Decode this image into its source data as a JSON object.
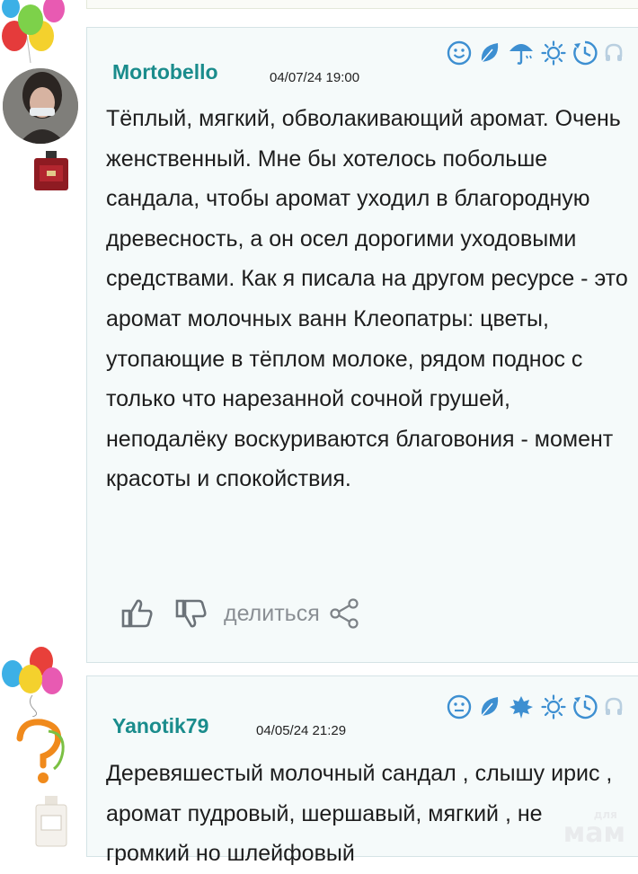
{
  "reviews": [
    {
      "author": "Mortobello",
      "date": "04/07/24 19:00",
      "text": "Тёплый, мягкий, обволакивающий аромат. Очень женственный. Мне бы хотелось побольше сандала, чтобы аромат уходил в благородную древесность, а он осел дорогими уходовыми средствами. Как я писала на другом ресурсе - это аромат молочных ванн Клеопатры: цветы, утопающие в тёплом молоке, рядом поднос с только что нарезанной сочной грушей, неподалёку воскуриваются благовония - момент красоты и спокойствия.",
      "icons": [
        "smiley-icon",
        "leaf-icon",
        "umbrella-icon",
        "sun-icon",
        "clock-icon",
        "headphones-icon"
      ]
    },
    {
      "author": "Yanotik79",
      "date": "04/05/24 21:29",
      "text": "Деревяшестый молочный сандал , слышу ирис , аромат пудровый, шершавый, мягкий , не громкий но шлейфовый",
      "icons": [
        "smiley-icon",
        "leaf-icon",
        "maple-leaf-icon",
        "sun-icon",
        "clock-icon",
        "headphones-icon"
      ]
    }
  ],
  "actions": {
    "share_label": "делиться"
  },
  "watermark": {
    "big": "мам",
    "small": "для"
  },
  "colors": {
    "author": "#1a8c8c",
    "icon": "#3d8fd1",
    "card_bg": "#f5fafa",
    "card_border": "#d5e3e6"
  }
}
